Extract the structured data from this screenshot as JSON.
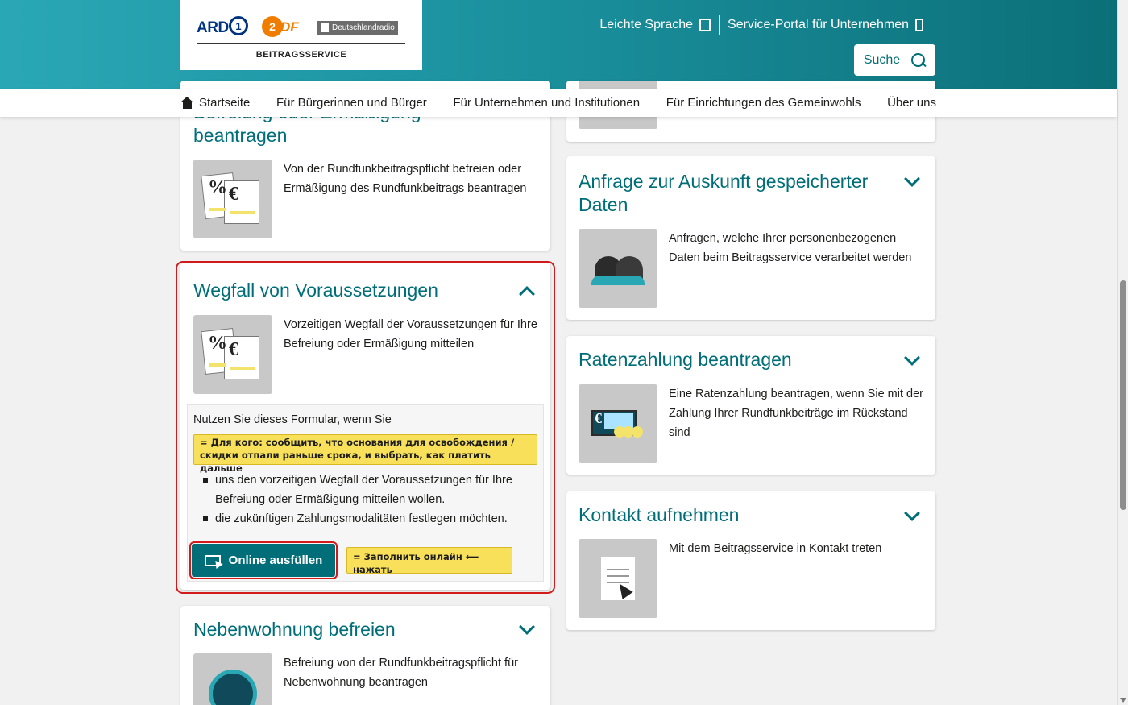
{
  "header": {
    "logo_ard": "ARD",
    "logo_ard_one": "1",
    "logo_zdf_mark": "2",
    "logo_zdf_text": "DF",
    "logo_dlr": "Deutschlandradio",
    "logo_sub": "BEITRAGSSERVICE",
    "link_easy_language": "Leichte Sprache",
    "link_business_portal": "Service-Portal für Unternehmen",
    "search_label": "Suche",
    "gradient_colors": [
      "#2aa7b5",
      "#0b6f78"
    ]
  },
  "nav": {
    "home": "Startseite",
    "citizens": "Für Bürgerinnen und Bürger",
    "companies": "Für Unternehmen und Institutionen",
    "charities": "Für Einrichtungen des Gemeinwohls",
    "about": "Über uns"
  },
  "left_column": {
    "card_exemption": {
      "title_partial": "Befreiung oder Ermäßigung",
      "title_rest": "beantragen",
      "description": "Von der Rundfunkbeitragspflicht befreien oder Ermäßigung des Rundfunkbeitrags beantragen",
      "icon": "percent-euro-documents-icon"
    },
    "card_wegfall": {
      "title": "Wegfall von Voraussetzungen",
      "description": "Vorzeitigen Wegfall der Voraussetzungen für Ihre Befreiung oder Ermäßigung mitteilen",
      "icon": "percent-euro-documents-icon",
      "form_intro": "Nutzen Sie dieses Formular, wenn Sie",
      "ru_note_who": "= Для кого: сообщить, что основания для освобождения / скидки отпали раньше срока, и выбрать, как платить дальше",
      "bullets": [
        "uns den vorzeitigen Wegfall der Voraussetzungen für Ihre Befreiung oder Ermäßigung mitteilen wollen.",
        "die zukünftigen Zahlungsmodalitäten festlegen möchten."
      ],
      "button_label": "Online ausfüllen",
      "ru_note_button": "= Заполнить онлайн ⟵ нажать"
    },
    "card_second_home": {
      "title": "Nebenwohnung befreien",
      "description": "Befreiung von der Rundfunkbeitragspflicht für Nebenwohnung beantragen",
      "icon": "second-home-icon"
    }
  },
  "right_column": {
    "card_data_request": {
      "title": "Anfrage zur Auskunft gespeicherter Daten",
      "description": "Anfragen, welche Ihrer personenbezogenen Daten beim Beitragsservice verarbeitet werden",
      "icon": "two-persons-icon"
    },
    "card_installments": {
      "title": "Ratenzahlung beantragen",
      "description": "Eine Ratenzahlung beantragen, wenn Sie mit der Zahlung Ihrer Rundfunkbeiträge im Rückstand sind",
      "icon": "euro-banknote-coins-icon"
    },
    "card_contact": {
      "title": "Kontakt aufnehmen",
      "description": "Mit dem Beitragsservice in Kontakt treten",
      "icon": "document-cursor-icon"
    }
  },
  "colors": {
    "accent": "#006e78",
    "highlight_red": "#d11a1a",
    "note_yellow": "#f9e05b"
  }
}
